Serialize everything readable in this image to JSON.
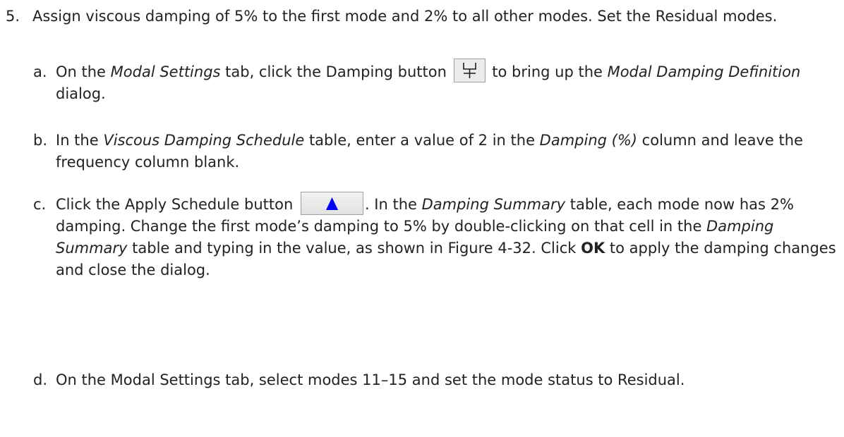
{
  "step": {
    "number": "5.",
    "text": "Assign viscous damping of 5% to the first mode and 2% to all other modes. Set the Residual modes."
  },
  "substeps": {
    "a": {
      "letter": "a.",
      "t1": "On the ",
      "em1": "Modal Settings",
      "t2": " tab, click the Damping button ",
      "t3": " to bring up the ",
      "em2": "Modal Damping Definition",
      "t4": " dialog."
    },
    "b": {
      "letter": "b.",
      "t1": "In the ",
      "em1": "Viscous Damping Schedule",
      "t2": " table, enter a value of 2 in the ",
      "em2": "Damping (%)",
      "t3": " column and leave the frequency column blank."
    },
    "c": {
      "letter": "c.",
      "t1": "Click the Apply Schedule button ",
      "t2": ". In the ",
      "em1": "Damping Summary",
      "t3": " table, each mode now has 2% damping. Change the first mode’s damping to 5% by double-clicking on that cell in the ",
      "em2": "Damping Summary",
      "t4": " table and typing in the value, as shown in Figure 4-32. Click ",
      "bold1": "OK",
      "t5": " to apply the damping changes and close the dialog."
    },
    "d": {
      "letter": "d.",
      "text": "On the Modal Settings tab, select modes 11–15 and set the mode status to Residual."
    }
  },
  "icons": {
    "damping_button": "damping-icon",
    "apply_schedule_button": "up-triangle-icon",
    "apply_triangle_color": "#0000ff"
  }
}
